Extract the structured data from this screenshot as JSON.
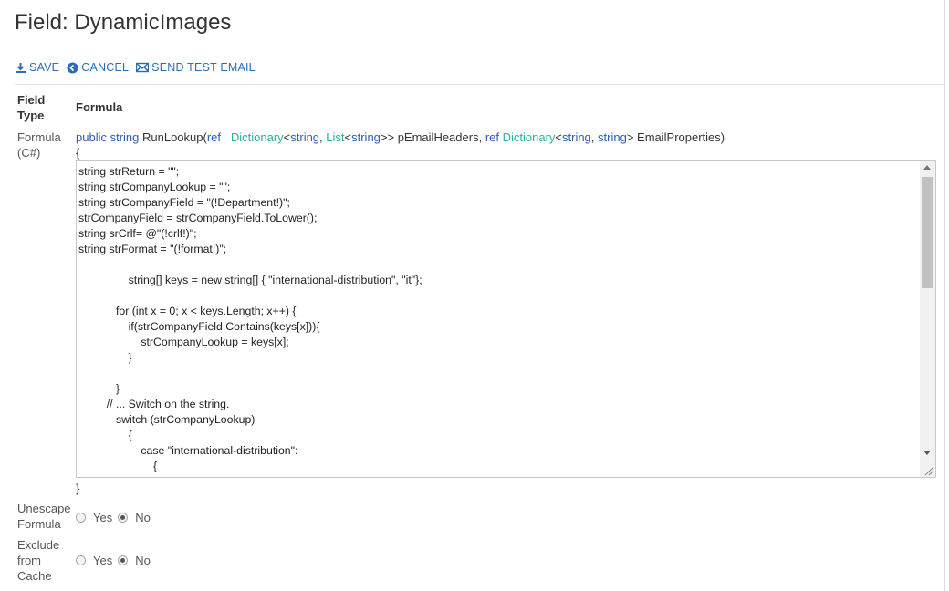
{
  "page": {
    "title": "Field: DynamicImages"
  },
  "toolbar": {
    "save_label": "SAVE",
    "cancel_label": "CANCEL",
    "send_test_email_label": "SEND TEST EMAIL"
  },
  "columns": {
    "field_type_header": "Field\nType",
    "formula_header": "Formula"
  },
  "formula_row": {
    "label": "Formula\n(C#)",
    "signature": {
      "public": "public",
      "string1": "string",
      "method": " RunLookup(",
      "ref1": "ref",
      "dict1": "Dictionary",
      "lt1": "<",
      "string2": "string",
      "comma1": ", ",
      "list": "List",
      "lt2": "<",
      "string3": "string",
      "gt2": ">> pEmailHeaders, ",
      "ref2": "ref",
      "dict2": "Dictionary",
      "lt3": "<",
      "string4": "string",
      "comma2": ", ",
      "string5": "string",
      "gt3": "> EmailProperties)"
    },
    "open_brace": "{",
    "close_brace": "}",
    "code": "string strReturn = \"\";\nstring strCompanyLookup = \"\";\nstring strCompanyField = \"(!Department!)\";\nstrCompanyField = strCompanyField.ToLower();\nstring srCrlf= @\"(!crlf!)\";\nstring strFormat = \"(!format!)\";\n\n                string[] keys = new string[] { \"international-distribution\", \"it\"};\n\n            for (int x = 0; x < keys.Length; x++) {\n                if(strCompanyField.Contains(keys[x])){\n                    strCompanyLookup = keys[x];\n                }\n\n            }\n         // ... Switch on the string.\n            switch (strCompanyLookup)\n                {\n                    case \"international-distribution\":\n                        {\n                            if(strFormat == \"html\")"
  },
  "unescape_row": {
    "label": "Unescape\nFormula",
    "yes_label": "Yes",
    "no_label": "No",
    "selected": "No"
  },
  "exclude_row": {
    "label": "Exclude\nfrom\nCache",
    "yes_label": "Yes",
    "no_label": "No",
    "selected": "No"
  },
  "colors": {
    "link": "#2a6fb0",
    "keyword": "#2a5db0",
    "type": "#2bafa4"
  },
  "icons": [
    "download-icon",
    "cancel-circle-icon",
    "envelope-icon"
  ]
}
